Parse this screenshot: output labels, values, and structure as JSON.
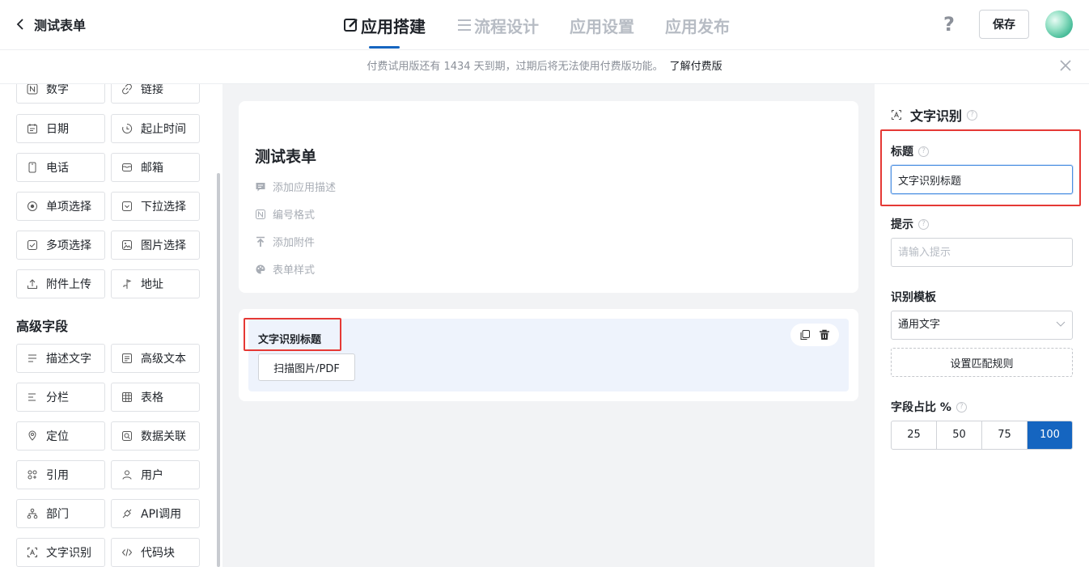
{
  "header": {
    "back_label": "测试表单",
    "tabs": [
      {
        "label": "应用搭建",
        "active": true
      },
      {
        "label": "流程设计",
        "active": false
      },
      {
        "label": "应用设置",
        "active": false
      },
      {
        "label": "应用发布",
        "active": false
      }
    ],
    "help_label": "?",
    "save_label": "保存"
  },
  "notice": {
    "text": "付费试用版还有 1434 天到期，过期后将无法使用付费版功能。",
    "link": "了解付费版"
  },
  "palette": {
    "basic_items": [
      {
        "label": "数字",
        "icon": "number-icon"
      },
      {
        "label": "链接",
        "icon": "link-icon"
      },
      {
        "label": "日期",
        "icon": "calendar-icon"
      },
      {
        "label": "起止时间",
        "icon": "time-range-icon"
      },
      {
        "label": "电话",
        "icon": "phone-icon"
      },
      {
        "label": "邮箱",
        "icon": "mail-icon"
      },
      {
        "label": "单项选择",
        "icon": "radio-icon"
      },
      {
        "label": "下拉选择",
        "icon": "dropdown-icon"
      },
      {
        "label": "多项选择",
        "icon": "checkbox-icon"
      },
      {
        "label": "图片选择",
        "icon": "image-icon"
      },
      {
        "label": "附件上传",
        "icon": "upload-icon"
      },
      {
        "label": "地址",
        "icon": "address-icon"
      }
    ],
    "advanced_heading": "高级字段",
    "advanced_items": [
      {
        "label": "描述文字",
        "icon": "description-icon"
      },
      {
        "label": "高级文本",
        "icon": "rich-text-icon"
      },
      {
        "label": "分栏",
        "icon": "columns-icon"
      },
      {
        "label": "表格",
        "icon": "table-icon"
      },
      {
        "label": "定位",
        "icon": "location-icon"
      },
      {
        "label": "数据关联",
        "icon": "data-link-icon"
      },
      {
        "label": "引用",
        "icon": "reference-icon"
      },
      {
        "label": "用户",
        "icon": "user-icon"
      },
      {
        "label": "部门",
        "icon": "department-icon"
      },
      {
        "label": "API调用",
        "icon": "api-icon"
      },
      {
        "label": "文字识别",
        "icon": "ocr-icon"
      },
      {
        "label": "代码块",
        "icon": "code-icon"
      }
    ]
  },
  "canvas": {
    "form_title": "测试表单",
    "links": [
      {
        "label": "添加应用描述",
        "icon": "comment-icon"
      },
      {
        "label": "编号格式",
        "icon": "number-format-icon"
      },
      {
        "label": "添加附件",
        "icon": "attachment-upload-icon"
      },
      {
        "label": "表单样式",
        "icon": "palette-icon"
      }
    ],
    "field": {
      "title": "文字识别标题",
      "scan_button": "扫描图片/PDF"
    }
  },
  "props": {
    "header": "文字识别",
    "title_label": "标题",
    "title_value": "文字识别标题",
    "hint_label": "提示",
    "hint_placeholder": "请输入提示",
    "template_label": "识别模板",
    "template_value": "通用文字",
    "rule_button": "设置匹配规则",
    "ratio_label": "字段占比 %",
    "ratio_options": [
      "25",
      "50",
      "75",
      "100"
    ],
    "ratio_selected": "100"
  },
  "colors": {
    "accent": "#1565c0",
    "highlight_box": "#e53935"
  }
}
